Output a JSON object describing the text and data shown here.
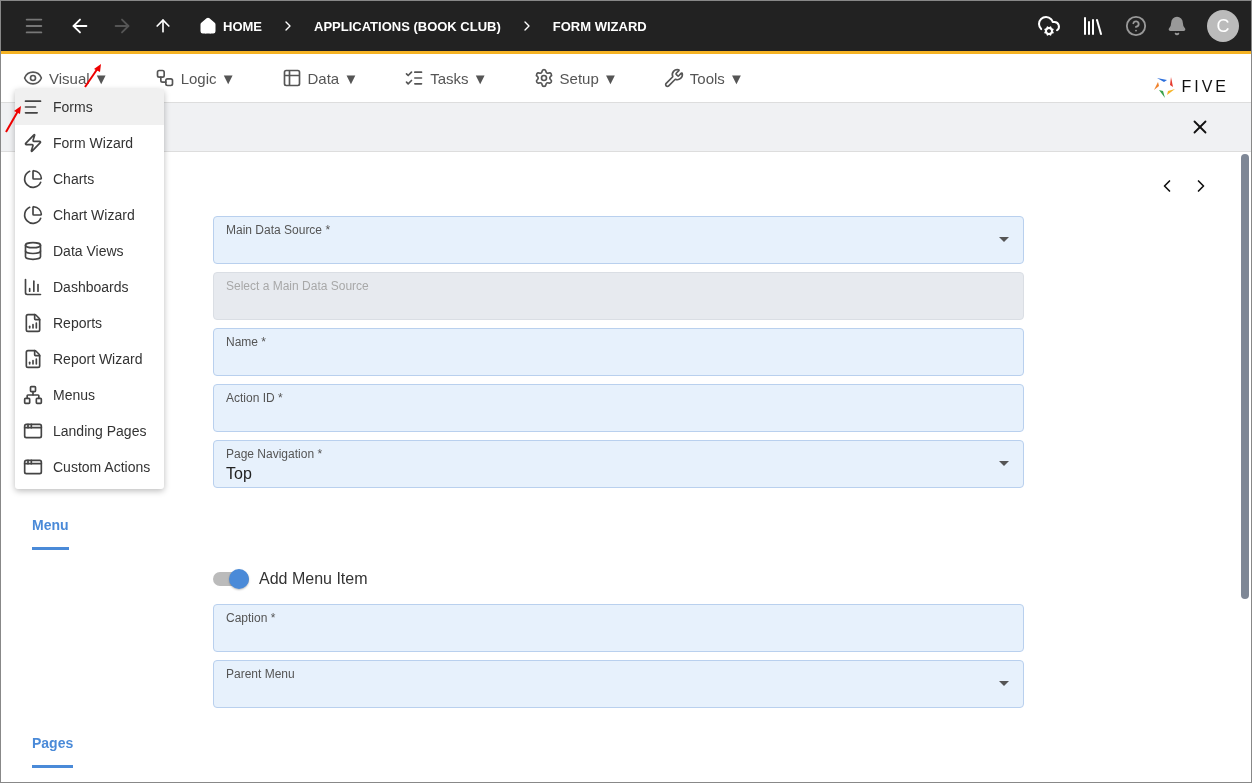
{
  "top_bar": {
    "breadcrumbs": [
      {
        "label": "HOME",
        "kind": "home"
      },
      {
        "label": "APPLICATIONS (BOOK CLUB)",
        "kind": "plain"
      },
      {
        "label": "FORM WIZARD",
        "kind": "plain"
      }
    ],
    "avatar": "C"
  },
  "menu_bar": {
    "items": [
      {
        "label": "Visual",
        "arrow": "▼"
      },
      {
        "label": "Logic",
        "arrow": "▼"
      },
      {
        "label": "Data",
        "arrow": "▼"
      },
      {
        "label": "Tasks",
        "arrow": "▼"
      },
      {
        "label": "Setup",
        "arrow": "▼"
      },
      {
        "label": "Tools",
        "arrow": "▼"
      }
    ],
    "logo": "FIVE"
  },
  "dropdown": {
    "items": [
      {
        "label": "Forms",
        "selected": true
      },
      {
        "label": "Form Wizard",
        "selected": false
      },
      {
        "label": "Charts",
        "selected": false
      },
      {
        "label": "Chart Wizard",
        "selected": false
      },
      {
        "label": "Data Views",
        "selected": false
      },
      {
        "label": "Dashboards",
        "selected": false
      },
      {
        "label": "Reports",
        "selected": false
      },
      {
        "label": "Report Wizard",
        "selected": false
      },
      {
        "label": "Menus",
        "selected": false
      },
      {
        "label": "Landing Pages",
        "selected": false
      },
      {
        "label": "Custom Actions",
        "selected": false
      }
    ]
  },
  "sections": [
    {
      "title": "Menu"
    },
    {
      "title": "Pages"
    }
  ],
  "fields": [
    {
      "label": "Main Data Source *",
      "kind": "select",
      "disabled": false
    },
    {
      "placeholder": "Select a Main Data Source",
      "kind": "text",
      "disabled": true
    },
    {
      "label": "Name *",
      "kind": "text",
      "disabled": false
    },
    {
      "label": "Action ID *",
      "kind": "text",
      "disabled": false
    },
    {
      "label": "Page Navigation *",
      "value": "Top",
      "kind": "select",
      "disabled": false
    }
  ],
  "toggle": {
    "label": "Add Menu Item",
    "on": true
  },
  "menu_fields": [
    {
      "label": "Caption *",
      "kind": "text",
      "disabled": false
    },
    {
      "label": "Parent Menu",
      "kind": "select",
      "disabled": false
    }
  ]
}
